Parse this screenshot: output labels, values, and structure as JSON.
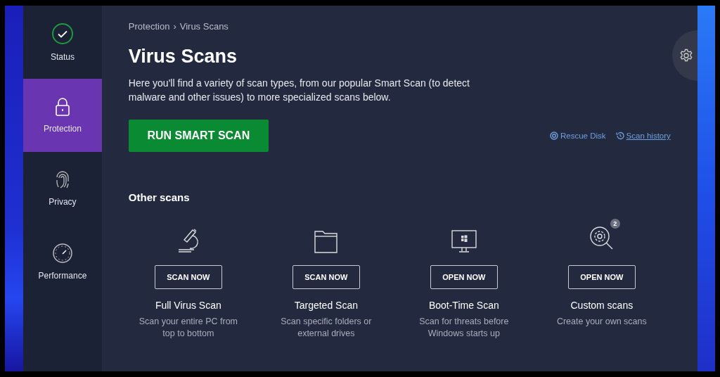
{
  "sidebar": {
    "items": [
      {
        "label": "Status",
        "kind": "status",
        "selected": false
      },
      {
        "label": "Protection",
        "kind": "protection",
        "selected": true
      },
      {
        "label": "Privacy",
        "kind": "privacy",
        "selected": false
      },
      {
        "label": "Performance",
        "kind": "performance",
        "selected": false
      }
    ]
  },
  "breadcrumb": {
    "items": [
      "Protection",
      "Virus Scans"
    ],
    "separator": "›"
  },
  "title": "Virus Scans",
  "description": "Here you'll find a variety of scan types, from our popular Smart Scan (to detect malware and other issues) to more specialized scans below.",
  "primary_button": "RUN SMART SCAN",
  "links": [
    {
      "label": "Rescue Disk",
      "kind": "rescue",
      "underlined": false
    },
    {
      "label": "Scan history",
      "kind": "history",
      "underlined": true
    }
  ],
  "section_title": "Other scans",
  "scans": [
    {
      "kind": "microscope",
      "button": "SCAN NOW",
      "title": "Full Virus Scan",
      "description": "Scan your entire PC from top to bottom"
    },
    {
      "kind": "folder",
      "button": "SCAN NOW",
      "title": "Targeted Scan",
      "description": "Scan specific folders or external drives"
    },
    {
      "kind": "monitor",
      "button": "OPEN NOW",
      "title": "Boot-Time Scan",
      "description": "Scan for threats before Windows starts up"
    },
    {
      "kind": "custom",
      "button": "OPEN NOW",
      "title": "Custom scans",
      "description": "Create your own scans",
      "badge": "2"
    }
  ]
}
